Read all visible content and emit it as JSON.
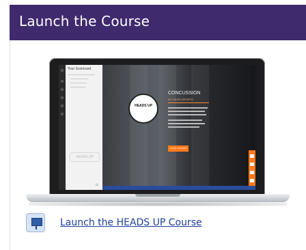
{
  "header": {
    "title": "Launch the Course"
  },
  "preview": {
    "sidebar_title": "Your Scorecard",
    "sidebar_logo": "HEADS UP",
    "home_icon": "home-icon",
    "hero_logo": "HEADS UP",
    "hero_title": "CONCUSSION",
    "hero_subtitle": "IN YOUTH SPORTS",
    "start_button": "START TRAINING",
    "tool_icons": [
      "document-icon",
      "phone-icon",
      "video-icon",
      "tool-icon"
    ]
  },
  "link": {
    "icon": "presentation-board-icon",
    "label": "Launch the HEADS UP Course"
  },
  "colors": {
    "header_bg": "#3f2a6e",
    "accent_orange": "#ff7a1a",
    "link": "#1f3f9a"
  }
}
